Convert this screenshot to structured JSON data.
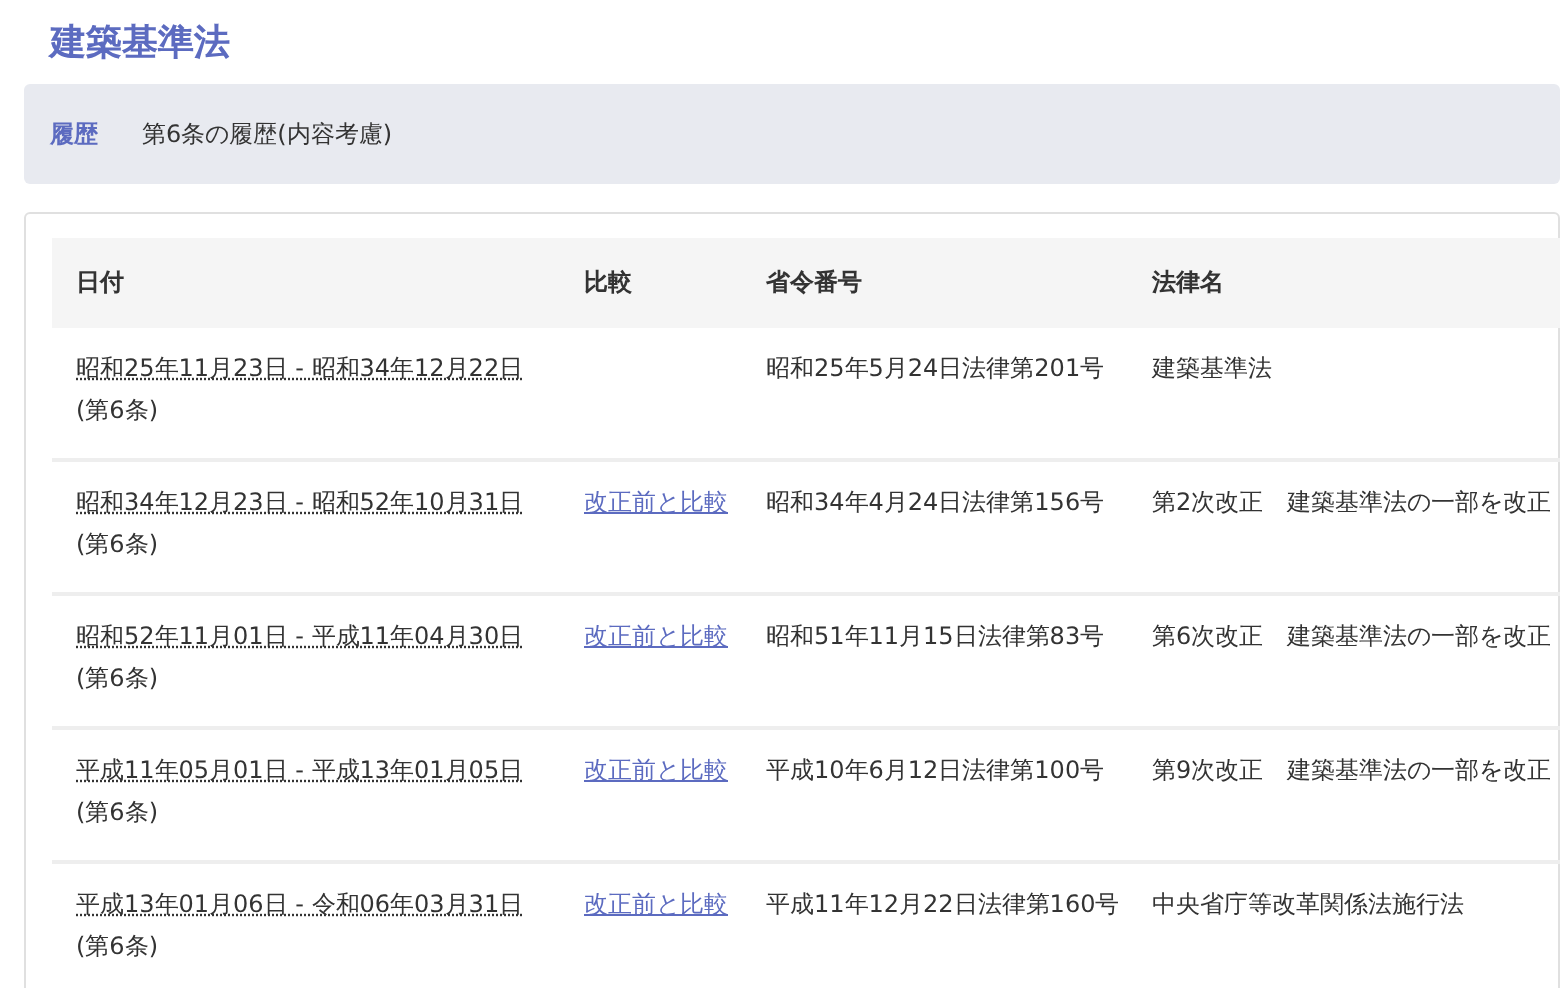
{
  "title": "建築基準法",
  "breadcrumb": {
    "label": "履歴",
    "text": "第6条の履歴(内容考慮)"
  },
  "table": {
    "columns": [
      "日付",
      "比較",
      "省令番号",
      "法律名"
    ],
    "rows": [
      {
        "date": "昭和25年11月23日 - 昭和34年12月22日",
        "article": "(第6条)",
        "number": "昭和25年5月24日法律第201号",
        "law": "建築基準法"
      },
      {
        "date": "昭和34年12月23日 - 昭和52年10月31日",
        "article": "(第6条)",
        "compare": "改正前と比較",
        "number": "昭和34年4月24日法律第156号",
        "law": "第2次改正　建築基準法の一部を改正"
      },
      {
        "date": "昭和52年11月01日 - 平成11年04月30日",
        "article": "(第6条)",
        "compare": "改正前と比較",
        "number": "昭和51年11月15日法律第83号",
        "law": "第6次改正　建築基準法の一部を改正"
      },
      {
        "date": "平成11年05月01日 - 平成13年01月05日",
        "article": "(第6条)",
        "compare": "改正前と比較",
        "number": "平成10年6月12日法律第100号",
        "law": "第9次改正　建築基準法の一部を改正"
      },
      {
        "date": "平成13年01月06日 - 令和06年03月31日",
        "article": "(第6条)",
        "compare": "改正前と比較",
        "number": "平成11年12月22日法律第160号",
        "law": "中央省庁等改革関係法施行法"
      }
    ]
  }
}
